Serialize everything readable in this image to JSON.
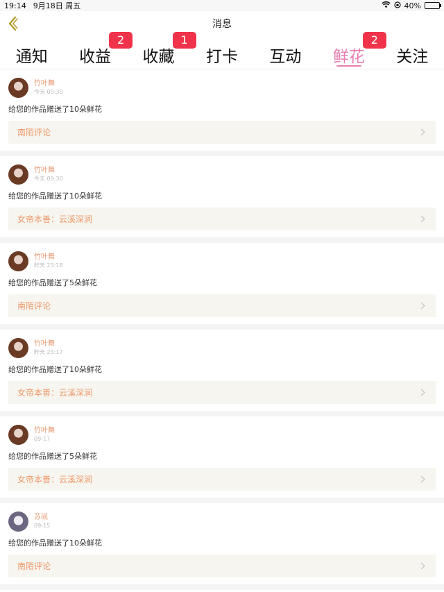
{
  "status_bar": {
    "time": "19:14",
    "date": "9月18日 周五",
    "battery": "40%",
    "battery_fraction": 0.4
  },
  "nav": {
    "title": "消息",
    "back_icon": "chevron-left-icon",
    "accent": "#b49b2a"
  },
  "tabs": [
    {
      "label": "通知",
      "badge": null
    },
    {
      "label": "收益",
      "badge": "2"
    },
    {
      "label": "收藏",
      "badge": "1"
    },
    {
      "label": "打卡",
      "badge": null
    },
    {
      "label": "互动",
      "badge": null
    },
    {
      "label": "鲜花",
      "badge": "2",
      "active": true
    },
    {
      "label": "关注",
      "badge": null
    }
  ],
  "colors": {
    "active_tab": "#e67eb0",
    "badge": "#f0334a",
    "username": "#e79a73",
    "ref_text": "#ee9a6b"
  },
  "messages": [
    {
      "user": "竹叶舞",
      "time": "今天 09:30",
      "text": "给您的作品赠送了10朵鲜花",
      "ref": "南陌评论",
      "avatar": "brown"
    },
    {
      "user": "竹叶舞",
      "time": "今天 09:30",
      "text": "给您的作品赠送了10朵鲜花",
      "ref": "女帝本善：云溪深涧",
      "avatar": "brown"
    },
    {
      "user": "竹叶舞",
      "time": "昨天 23:18",
      "text": "给您的作品赠送了5朵鲜花",
      "ref": "南陌评论",
      "avatar": "brown"
    },
    {
      "user": "竹叶舞",
      "time": "昨天 23:17",
      "text": "给您的作品赠送了10朵鲜花",
      "ref": "女帝本善：云溪深涧",
      "avatar": "brown"
    },
    {
      "user": "竹叶舞",
      "time": "09-17",
      "text": "给您的作品赠送了5朵鲜花",
      "ref": "女帝本善：云溪深涧",
      "avatar": "brown"
    },
    {
      "user": "苏砚",
      "time": "09-15",
      "text": "给您的作品赠送了10朵鲜花",
      "ref": "南陌评论",
      "avatar": "grey"
    }
  ]
}
